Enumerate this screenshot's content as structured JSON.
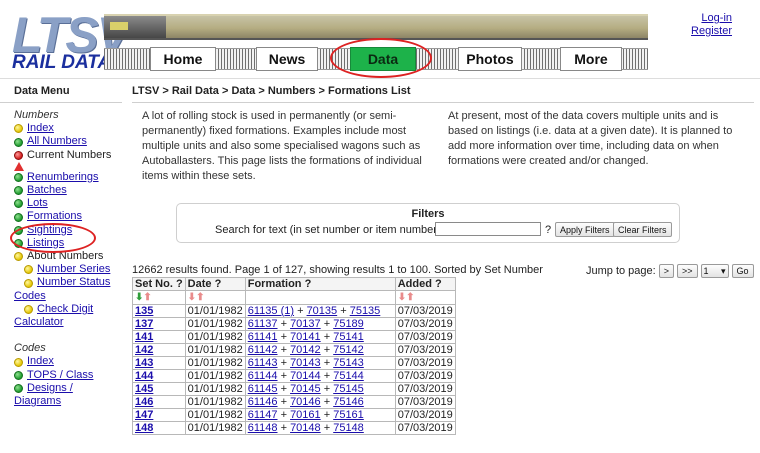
{
  "header": {
    "logo_letters": "LTSV",
    "logo_sub": "RAIL DATA",
    "nav": [
      "Home",
      "News",
      "Data",
      "Photos",
      "More"
    ],
    "active_nav": "Data",
    "login": "Log-in",
    "register": "Register"
  },
  "sidebar": {
    "title": "Data Menu",
    "sections": [
      {
        "heading": "Numbers",
        "items": [
          {
            "label": "Index",
            "dot": "yellow",
            "link": true
          },
          {
            "label": "All Numbers",
            "dot": "green",
            "link": true
          },
          {
            "label": "Current Numbers",
            "dot": "red",
            "link": false
          },
          {
            "label": "",
            "dot": "triangle",
            "link": false
          },
          {
            "label": "Renumberings",
            "dot": "green",
            "link": true
          },
          {
            "label": "Batches",
            "dot": "green",
            "link": true
          },
          {
            "label": "Lots",
            "dot": "green",
            "link": true
          },
          {
            "label": "Formations",
            "dot": "green",
            "link": true
          },
          {
            "label": "Sightings",
            "dot": "green",
            "link": true
          },
          {
            "label": "Listings",
            "dot": "green",
            "link": true
          },
          {
            "label": "About Numbers",
            "dot": "yellow",
            "link": false
          },
          {
            "label": "Number Series",
            "dot": "yellow",
            "link": true,
            "indent": true
          },
          {
            "label": "Number Status",
            "dot": "yellow",
            "link": true,
            "indent": true
          },
          {
            "label": "Codes",
            "dot": "none",
            "link": true
          },
          {
            "label": "Check Digit",
            "dot": "yellow",
            "link": true,
            "indent": true
          },
          {
            "label": "Calculator",
            "dot": "none",
            "link": true
          }
        ]
      },
      {
        "heading": "Codes",
        "items": [
          {
            "label": "Index",
            "dot": "yellow",
            "link": true
          },
          {
            "label": "TOPS / Class",
            "dot": "green",
            "link": true
          },
          {
            "label": "Designs /",
            "dot": "green",
            "link": true
          },
          {
            "label": "Diagrams",
            "dot": "none",
            "link": true
          }
        ]
      }
    ]
  },
  "main": {
    "breadcrumb": "LTSV > Rail Data > Data > Numbers > Formations List",
    "intro_left": "A lot of rolling stock is used in permanently (or semi-permanently) fixed formations. Examples include most multiple units and also some specialised wagons such as Autoballasters. This page lists the formations of individual items within these sets.",
    "intro_right": "At present, most of the data covers multiple units and is based on listings (i.e. data at a given date). It is planned to add more information over time, including data on when formations were created and/or changed.",
    "filters": {
      "title": "Filters",
      "label": "Search for text (in set number or item numbers):",
      "input_value": "",
      "help": "?",
      "apply": "Apply Filters",
      "clear": "Clear Filters"
    },
    "results_text": "12662 results found. Page 1 of 127, showing results 1 to 100. Sorted by Set Number",
    "jump": {
      "label": "Jump to page:",
      "next": ">",
      "last": ">>",
      "page": "1",
      "go": "Go"
    },
    "table": {
      "headers": [
        "Set No. ?",
        "Date ?",
        "Formation ?",
        "Added ?"
      ],
      "rows": [
        {
          "set": "135",
          "date": "01/01/1982",
          "items": [
            "61135 (1)",
            "70135",
            "75135"
          ],
          "added": "07/03/2019"
        },
        {
          "set": "137",
          "date": "01/01/1982",
          "items": [
            "61137",
            "70137",
            "75189"
          ],
          "added": "07/03/2019"
        },
        {
          "set": "141",
          "date": "01/01/1982",
          "items": [
            "61141",
            "70141",
            "75141"
          ],
          "added": "07/03/2019"
        },
        {
          "set": "142",
          "date": "01/01/1982",
          "items": [
            "61142",
            "70142",
            "75142"
          ],
          "added": "07/03/2019"
        },
        {
          "set": "143",
          "date": "01/01/1982",
          "items": [
            "61143",
            "70143",
            "75143"
          ],
          "added": "07/03/2019"
        },
        {
          "set": "144",
          "date": "01/01/1982",
          "items": [
            "61144",
            "70144",
            "75144"
          ],
          "added": "07/03/2019"
        },
        {
          "set": "145",
          "date": "01/01/1982",
          "items": [
            "61145",
            "70145",
            "75145"
          ],
          "added": "07/03/2019"
        },
        {
          "set": "146",
          "date": "01/01/1982",
          "items": [
            "61146",
            "70146",
            "75146"
          ],
          "added": "07/03/2019"
        },
        {
          "set": "147",
          "date": "01/01/1982",
          "items": [
            "61147",
            "70161",
            "75161"
          ],
          "added": "07/03/2019"
        },
        {
          "set": "148",
          "date": "01/01/1982",
          "items": [
            "61148",
            "70148",
            "75148"
          ],
          "added": "07/03/2019"
        }
      ]
    }
  },
  "colors": {
    "link": "#1a0dab",
    "nav_active": "#1db24a",
    "highlight_ring": "#dd2222"
  },
  "icons": {
    "sort_asc": "arrow-up-icon",
    "sort_desc": "arrow-down-icon"
  }
}
